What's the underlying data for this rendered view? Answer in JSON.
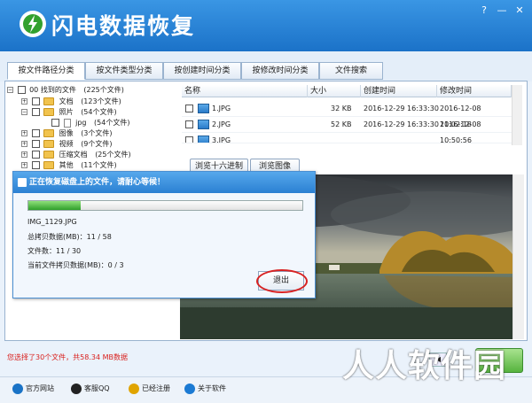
{
  "app": {
    "title": "闪电数据恢复",
    "logo_icon": "lightning-icon"
  },
  "window": {
    "help": "?",
    "minimize": "—",
    "close": "✕"
  },
  "tabs": [
    {
      "label": "按文件路径分类",
      "active": true
    },
    {
      "label": "按文件类型分类",
      "active": false
    },
    {
      "label": "按创建时间分类",
      "active": false
    },
    {
      "label": "按修改时间分类",
      "active": false
    },
    {
      "label": "文件搜索",
      "active": false
    }
  ],
  "tree": {
    "root": {
      "label": "00 找到的文件",
      "count": "(225个文件)"
    },
    "items": [
      {
        "label": "文档",
        "count": "(123个文件)"
      },
      {
        "label": "照片",
        "count": "(54个文件)"
      },
      {
        "label": "jpg",
        "count": "(54个文件)"
      },
      {
        "label": "图像",
        "count": "(3个文件)"
      },
      {
        "label": "视频",
        "count": "(9个文件)"
      },
      {
        "label": "压缩文档",
        "count": "(25个文件)"
      },
      {
        "label": "其他",
        "count": "(11个文件)"
      }
    ]
  },
  "file_list": {
    "columns": [
      "名称",
      "大小",
      "创建时间",
      "修改时间"
    ],
    "rows": [
      {
        "name": "1.JPG",
        "size": "32 KB",
        "created": "2016-12-29  16:33:30",
        "modified": "2016-12-08  11:02:18"
      },
      {
        "name": "2.JPG",
        "size": "52 KB",
        "created": "2016-12-29  16:33:30",
        "modified": "2016-12-08  10:50:56"
      },
      {
        "name": "3.JPG",
        "size": "",
        "created": "",
        "modified": ""
      }
    ]
  },
  "preview_tabs": {
    "hex": "浏览十六进制",
    "image": "浏览图像"
  },
  "dialog": {
    "title": "正在恢复磁盘上的文件，请耐心等候！",
    "progress": 0.19,
    "file_name": "IMG_1129.JPG",
    "total_label": "总拷贝数据(MB)：",
    "total_value": "11 / 58",
    "files_label": "文件数：",
    "files_value": "11 / 30",
    "current_label": "当前文件拷贝数据(MB)：",
    "current_value": "0 / 3",
    "exit_label": "退出"
  },
  "status_text": "您选择了30个文件，共58.34 MB数据",
  "bottom_links": [
    {
      "label": "官方网站",
      "icon": "ie-icon",
      "color": "#1a73c6"
    },
    {
      "label": "客服QQ",
      "icon": "qq-icon",
      "color": "#222222"
    },
    {
      "label": "已经注册",
      "icon": "key-icon",
      "color": "#e0a400"
    },
    {
      "label": "关于软件",
      "icon": "globe-icon",
      "color": "#1b7ad3"
    }
  ],
  "watermark": "人人软件园"
}
